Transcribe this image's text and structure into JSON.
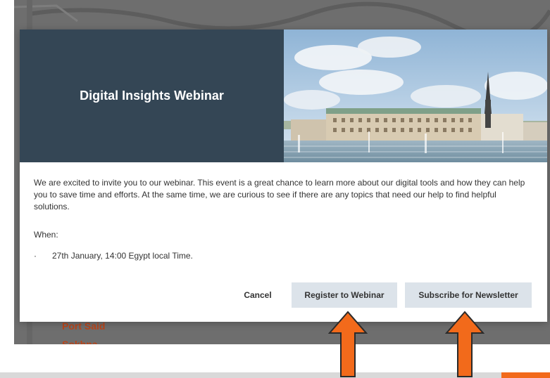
{
  "background_page": {
    "list_items": [
      "Port Said",
      "Sokhna"
    ]
  },
  "modal": {
    "hero": {
      "title": "Digital Insights Webinar",
      "image_alt": "city skyline by the water"
    },
    "body": {
      "intro": "We are excited to invite you to our webinar. This event is a great chance to learn more about our digital tools and how they can help you to save time and efforts. At the same time, we are curious to see if there are any topics that need our help to find helpful solutions.",
      "when_label": "When:",
      "bullet": "·",
      "date": "27th January, 14:00 Egypt local Time."
    },
    "buttons": {
      "cancel": "Cancel",
      "register": "Register to Webinar",
      "subscribe": "Subscribe for Newsletter"
    }
  },
  "colors": {
    "hero_panel": "#344655",
    "button_bg": "#dce3ea",
    "annotation_arrow": "#f26a1b",
    "link_text": "#b8451b"
  }
}
